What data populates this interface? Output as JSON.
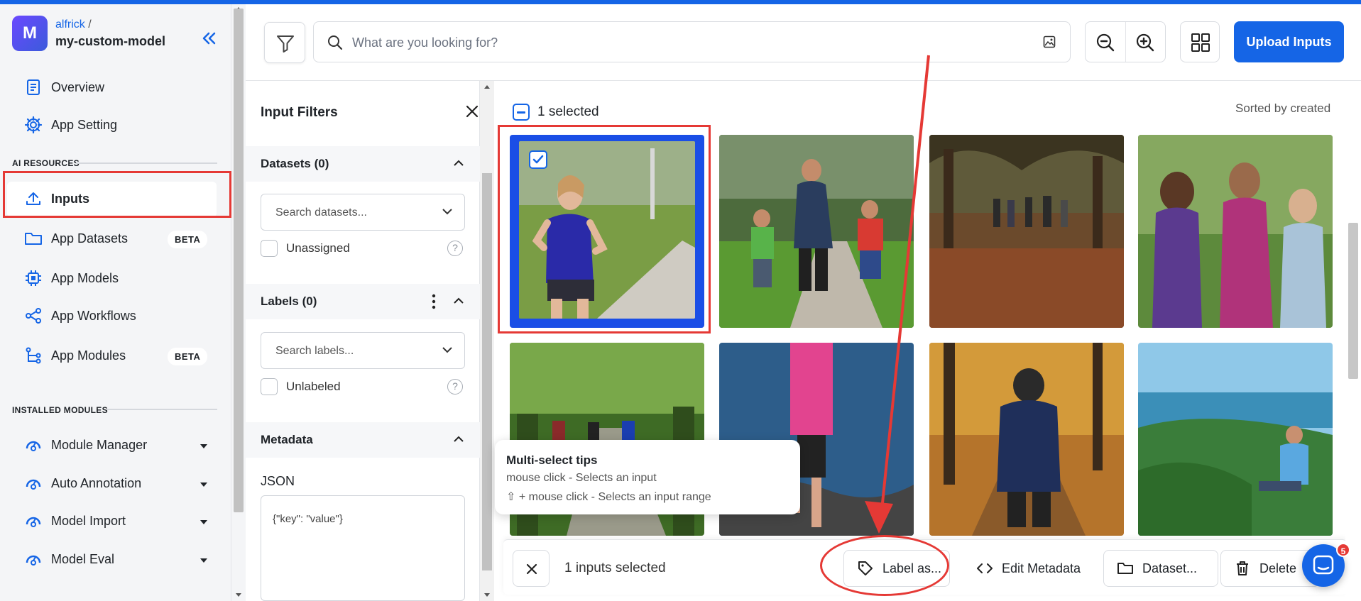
{
  "app": {
    "avatar_letter": "M",
    "user": "alfrick",
    "user_sep": "/",
    "app_id": "my-custom-model"
  },
  "sidebar": {
    "top_items": [
      {
        "label": "Overview",
        "icon": "document-icon"
      },
      {
        "label": "App Setting",
        "icon": "gear-icon"
      }
    ],
    "ai_resources_heading": "AI RESOURCES",
    "ai_items": [
      {
        "label": "Inputs",
        "icon": "upload-icon",
        "active": true
      },
      {
        "label": "App Datasets",
        "icon": "folder-icon",
        "badge": "BETA"
      },
      {
        "label": "App Models",
        "icon": "chip-icon"
      },
      {
        "label": "App Workflows",
        "icon": "share-icon"
      },
      {
        "label": "App Modules",
        "icon": "modules-icon",
        "badge": "BETA"
      }
    ],
    "installed_heading": "INSTALLED MODULES",
    "modules": [
      {
        "label": "Module Manager",
        "icon": "module-icon"
      },
      {
        "label": "Auto Annotation",
        "icon": "module-icon"
      },
      {
        "label": "Model Import",
        "icon": "module-icon"
      },
      {
        "label": "Model Eval",
        "icon": "module-icon"
      }
    ]
  },
  "filters": {
    "title": "Input Filters",
    "datasets": {
      "title": "Datasets (0)",
      "placeholder": "Search datasets...",
      "checkbox": "Unassigned"
    },
    "labels": {
      "title": "Labels (0)",
      "placeholder": "Search labels...",
      "checkbox": "Unlabeled"
    },
    "metadata": {
      "title": "Metadata",
      "json_label": "JSON",
      "json_placeholder": "{\"key\": \"value\"}"
    }
  },
  "toolbar": {
    "search_placeholder": "What are you looking for?",
    "upload_label": "Upload Inputs"
  },
  "content": {
    "selected_text": "1 selected",
    "sorted_text": "Sorted by created",
    "images": [
      {
        "desc": "girl running on path",
        "selected": true
      },
      {
        "desc": "family walking in park"
      },
      {
        "desc": "people walking under trees"
      },
      {
        "desc": "women jogging"
      },
      {
        "desc": "runners on forest trail"
      },
      {
        "desc": "woman running by water"
      },
      {
        "desc": "man in autumn park"
      },
      {
        "desc": "man sitting on coast"
      }
    ]
  },
  "tips": {
    "title": "Multi-select tips",
    "line1": "mouse click - Selects an input",
    "line2": "⇧ + mouse click - Selects an input range"
  },
  "actionbar": {
    "count": "1 inputs selected",
    "label_btn": "Label as...",
    "metadata_btn": "Edit Metadata",
    "dataset_btn": "Dataset...",
    "delete_btn": "Delete"
  },
  "chat": {
    "badge": "5"
  },
  "colors": {
    "accent": "#1565e6",
    "annotation": "#e53935"
  }
}
